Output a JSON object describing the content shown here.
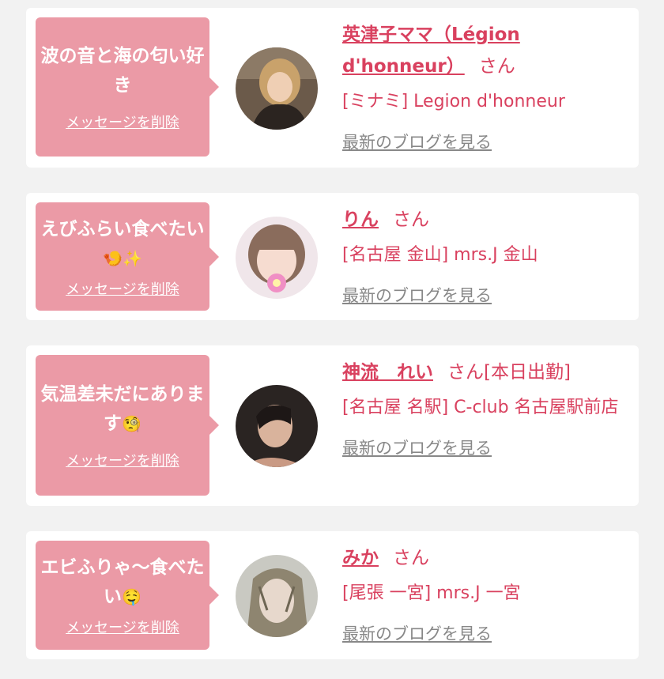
{
  "colors": {
    "bubble": "#eb9aa6",
    "accent": "#d9415f",
    "muted": "#888888",
    "page_bg": "#f2f2f2",
    "card_bg": "#ffffff"
  },
  "entries": [
    {
      "message": "波の音と海の匂い好き",
      "message_emoji": "",
      "delete_label": "メッセージを削除",
      "name": "英津子ママ（Légion d'honneur）",
      "honorific": "さん",
      "status": "",
      "shop": "[ミナミ] Legion d'honneur",
      "blog_label": "最新のブログを見る",
      "avatar_icon": "profile-photo"
    },
    {
      "message": "えびふらい食べたい",
      "message_emoji": "🍤✨",
      "delete_label": "メッセージを削除",
      "name": "りん",
      "honorific": "さん",
      "status": "",
      "shop": "[名古屋 金山] mrs.J 金山",
      "blog_label": "最新のブログを見る",
      "avatar_icon": "profile-photo"
    },
    {
      "message": "気温差未だにあります",
      "message_emoji": "🧐",
      "delete_label": "メッセージを削除",
      "name": "神流　れい",
      "honorific": "さん",
      "status": "[本日出勤]",
      "shop": "[名古屋 名駅] C-club 名古屋駅前店",
      "blog_label": "最新のブログを見る",
      "avatar_icon": "profile-photo"
    },
    {
      "message": "エビふりゃ〜食べたい",
      "message_emoji": "🤤",
      "delete_label": "メッセージを削除",
      "name": "みか",
      "honorific": "さん",
      "status": "",
      "shop": "[尾張 一宮] mrs.J 一宮",
      "blog_label": "最新のブログを見る",
      "avatar_icon": "profile-photo"
    }
  ]
}
